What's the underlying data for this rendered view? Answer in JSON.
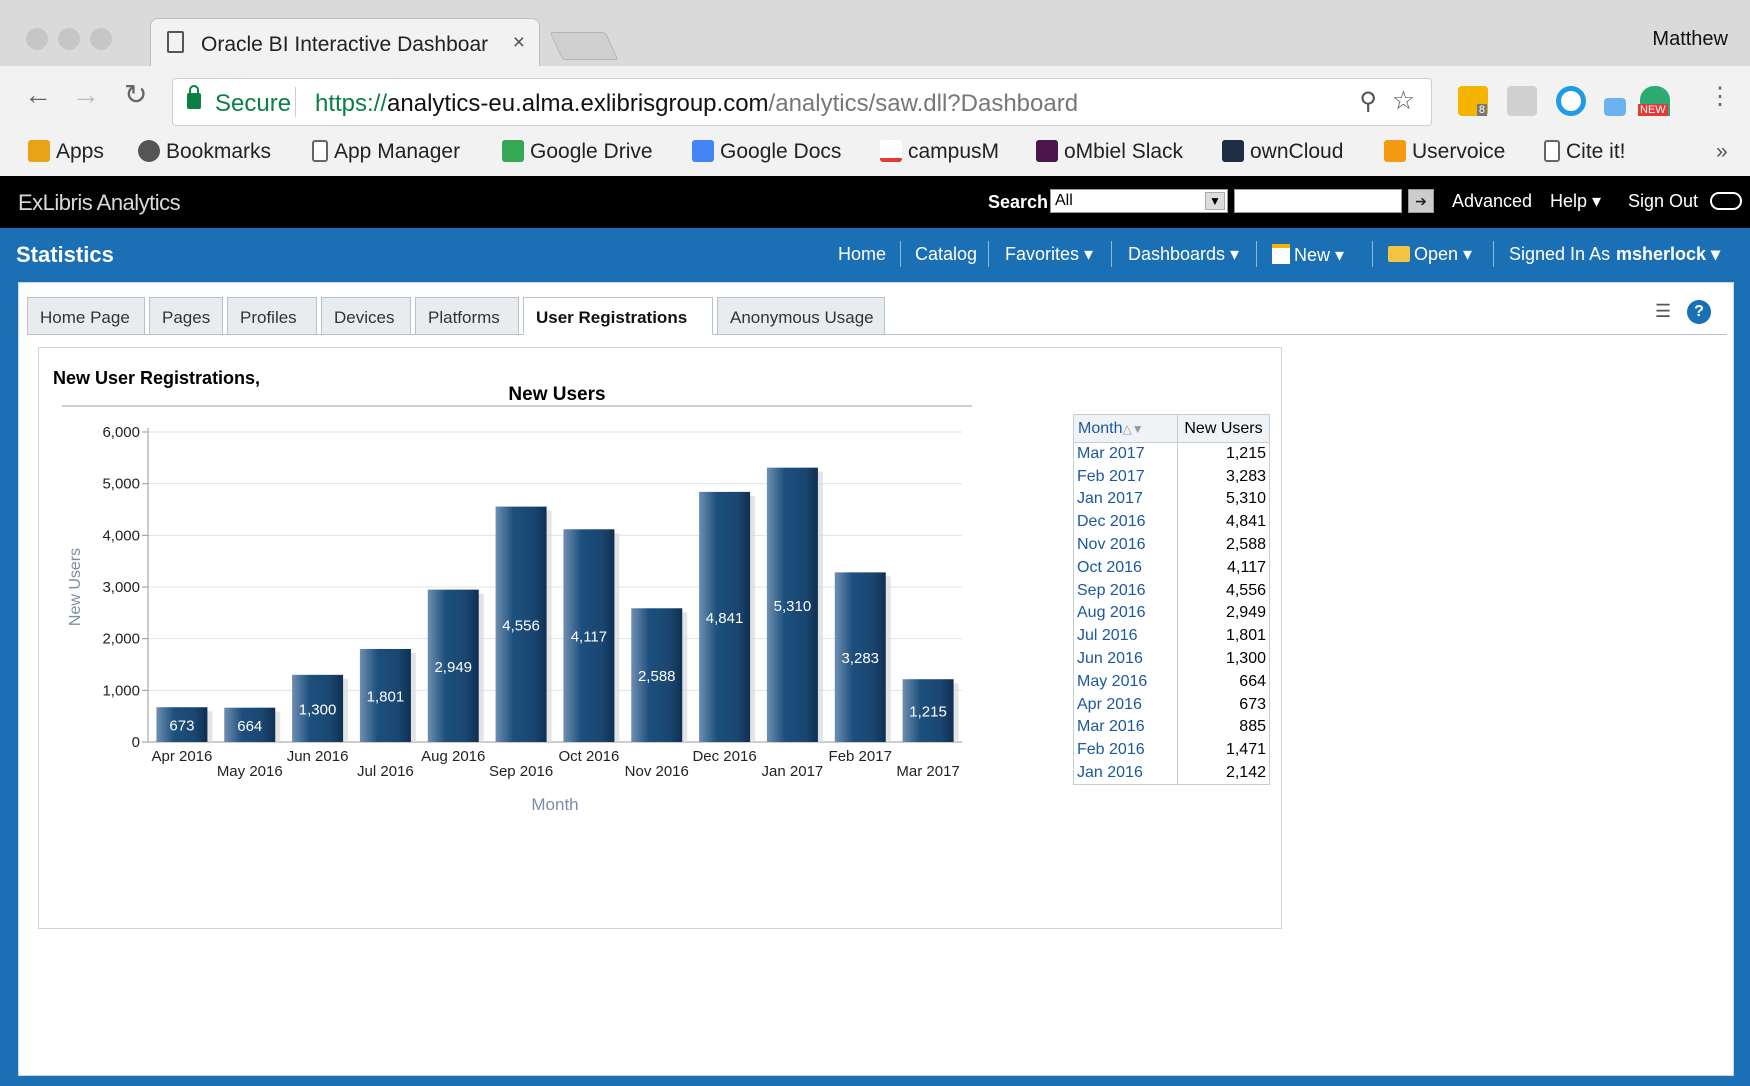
{
  "browser": {
    "tab_title": "Oracle BI Interactive Dashboar",
    "profile": "Matthew",
    "secure_label": "Secure",
    "url_scheme": "https://",
    "url_host": "analytics-eu.alma.exlibrisgroup.com",
    "url_path": "/analytics/saw.dll?Dashboard",
    "extension_badge_new": "NEW",
    "extension_badge_count": "8",
    "bookmarks": [
      "Apps",
      "Bookmarks",
      "App Manager",
      "Google Drive",
      "Google Docs",
      "campusM",
      "oMbiel Slack",
      "ownCloud",
      "Uservoice",
      "Cite it!"
    ],
    "bookmarks_overflow": "»"
  },
  "header": {
    "logo_text": "ExLibris Analytics",
    "search_label": "Search",
    "search_scope": "All",
    "advanced": "Advanced",
    "help": "Help ▾",
    "sign_out": "Sign Out"
  },
  "bar": {
    "title": "Statistics",
    "home": "Home",
    "catalog": "Catalog",
    "favorites": "Favorites ▾",
    "dashboards": "Dashboards ▾",
    "new": "New ▾",
    "open": "Open ▾",
    "signed_in_as": "Signed In As",
    "username": "msherlock ▾"
  },
  "dash_tabs": [
    "Home Page",
    "Pages",
    "Profiles",
    "Devices",
    "Platforms",
    "User Registrations",
    "Anonymous Usage"
  ],
  "active_tab": "User Registrations",
  "report_title": "New User Registrations,",
  "chart_data": {
    "type": "bar",
    "title": "New Users",
    "xlabel": "Month",
    "ylabel": "New Users",
    "ylim": [
      0,
      6000
    ],
    "yticks": [
      "0",
      "1,000",
      "2,000",
      "3,000",
      "4,000",
      "5,000",
      "6,000"
    ],
    "categories": [
      "Apr 2016",
      "May 2016",
      "Jun 2016",
      "Jul 2016",
      "Aug 2016",
      "Sep 2016",
      "Oct 2016",
      "Nov 2016",
      "Dec 2016",
      "Jan 2017",
      "Feb 2017",
      "Mar 2017"
    ],
    "values": [
      673,
      664,
      1300,
      1801,
      2949,
      4556,
      4117,
      2588,
      4841,
      5310,
      3283,
      1215
    ],
    "value_labels": [
      "673",
      "664",
      "1,300",
      "1,801",
      "2,949",
      "4,556",
      "4,117",
      "2,588",
      "4,841",
      "5,310",
      "3,283",
      "1,215"
    ],
    "bar_color": "#1d4f7e"
  },
  "table": {
    "headers": [
      "Month",
      "New Users"
    ],
    "rows": [
      [
        "Mar 2017",
        "1,215"
      ],
      [
        "Feb 2017",
        "3,283"
      ],
      [
        "Jan 2017",
        "5,310"
      ],
      [
        "Dec 2016",
        "4,841"
      ],
      [
        "Nov 2016",
        "2,588"
      ],
      [
        "Oct 2016",
        "4,117"
      ],
      [
        "Sep 2016",
        "4,556"
      ],
      [
        "Aug 2016",
        "2,949"
      ],
      [
        "Jul 2016",
        "1,801"
      ],
      [
        "Jun 2016",
        "1,300"
      ],
      [
        "May 2016",
        "664"
      ],
      [
        "Apr 2016",
        "673"
      ],
      [
        "Mar 2016",
        "885"
      ],
      [
        "Feb 2016",
        "1,471"
      ],
      [
        "Jan 2016",
        "2,142"
      ]
    ]
  }
}
